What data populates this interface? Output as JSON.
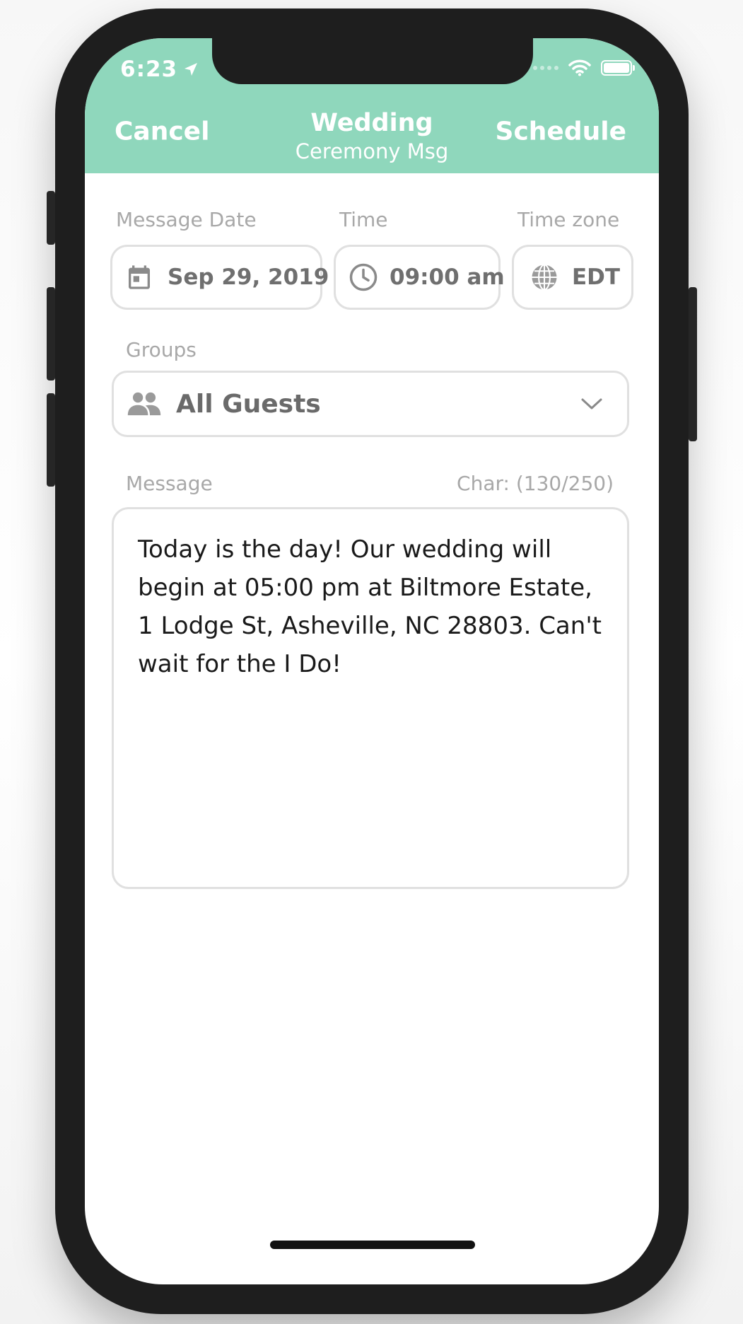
{
  "status_bar": {
    "time": "6:23"
  },
  "nav": {
    "cancel_label": "Cancel",
    "title": "Wedding",
    "subtitle": "Ceremony Msg",
    "schedule_label": "Schedule"
  },
  "fields": {
    "date_label": "Message Date",
    "date_value": "Sep 29, 2019",
    "time_label": "Time",
    "time_value": "09:00 am",
    "timezone_label": "Time zone",
    "timezone_value": "EDT",
    "groups_label": "Groups",
    "groups_value": "All Guests",
    "message_label": "Message",
    "char_count": "Char: (130/250)",
    "message_text": "Today is the day! Our wedding will begin at 05:00 pm at Biltmore Estate, 1 Lodge St, Asheville, NC 28803. Can't wait for the I Do!"
  },
  "colors": {
    "header_bg": "#8fd7bc",
    "field_border": "#e0e0e0",
    "label_text": "#a8a8a8",
    "value_text": "#6f6f6f"
  },
  "icons": {
    "date": "calendar-icon",
    "time": "clock-icon",
    "timezone": "globe-icon",
    "groups": "people-icon",
    "dropdown": "chevron-down-icon"
  }
}
